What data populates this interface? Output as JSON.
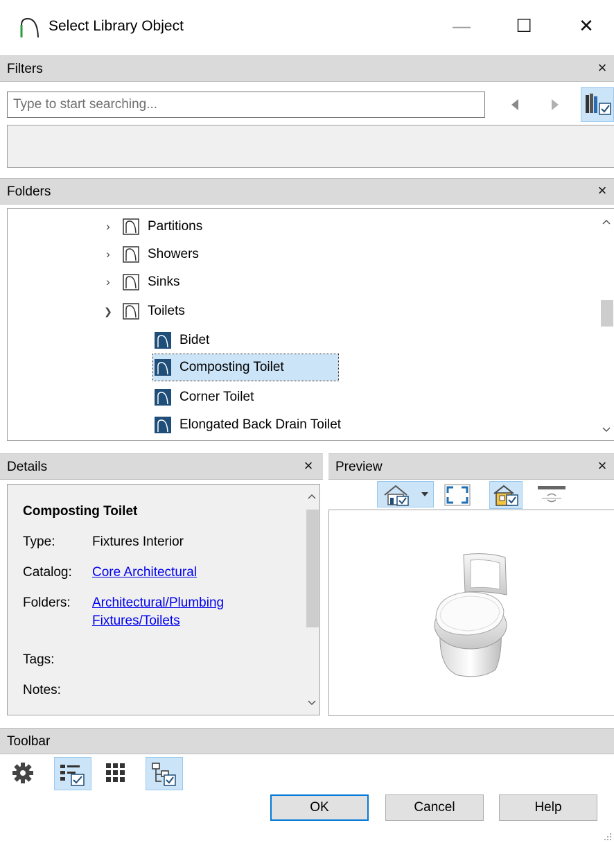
{
  "window": {
    "title": "Select Library Object",
    "minimize": "—",
    "maximize": "☐",
    "close": "✕"
  },
  "filters": {
    "header": "Filters",
    "close": "×",
    "search_placeholder": "Type to start searching..."
  },
  "folders": {
    "header": "Folders",
    "close": "×",
    "items": [
      {
        "label": "Partitions",
        "kind": "folder",
        "expanded": false
      },
      {
        "label": "Showers",
        "kind": "folder",
        "expanded": false
      },
      {
        "label": "Sinks",
        "kind": "folder",
        "expanded": false
      },
      {
        "label": "Toilets",
        "kind": "folder",
        "expanded": true
      },
      {
        "label": "Bidet",
        "kind": "object"
      },
      {
        "label": "Composting Toilet",
        "kind": "object",
        "selected": true
      },
      {
        "label": "Corner Toilet",
        "kind": "object"
      },
      {
        "label": "Elongated Back Drain Toilet",
        "kind": "object"
      }
    ]
  },
  "details": {
    "header": "Details",
    "close": "×",
    "name": "Composting Toilet",
    "type_label": "Type:",
    "type_value": "Fixtures Interior",
    "catalog_label": "Catalog:",
    "catalog_value": "Core Architectural",
    "folders_label": "Folders:",
    "folders_value_line1": "Architectural/Plumbing",
    "folders_value_line2": "Fixtures/Toilets",
    "tags_label": "Tags:",
    "notes_label": "Notes:"
  },
  "preview": {
    "header": "Preview",
    "close": "×"
  },
  "toolbar": {
    "header": "Toolbar",
    "ok": "OK",
    "cancel": "Cancel",
    "help": "Help"
  },
  "colors": {
    "accent": "#0078d7",
    "selection": "#cce4f7",
    "panel_header": "#dadada",
    "icon_blue": "#1f4e79"
  }
}
